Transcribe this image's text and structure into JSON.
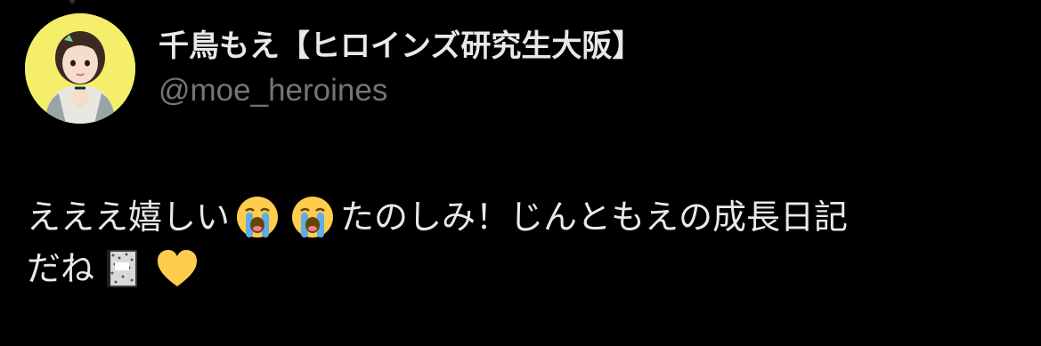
{
  "author": {
    "display_name": "千鳥もえ【ヒロインズ研究生大阪】",
    "handle": "@moe_heroines",
    "avatar_icon": "user-avatar-photo"
  },
  "tweet": {
    "line1": {
      "text_a": "えええ嬉しい",
      "emoji_1": "loudly-crying-face-icon",
      "emoji_2": "loudly-crying-face-icon",
      "text_b": "たのしみ！じんともえの成長日記"
    },
    "line2": {
      "text_a": "だね",
      "emoji_1": "notebook-icon",
      "emoji_2": "yellow-heart-icon"
    }
  },
  "colors": {
    "background": "#000000",
    "text_primary": "#e7e9ea",
    "text_secondary": "#71767b",
    "avatar_bg": "#f5ee6a",
    "heart": "#ffcc4d"
  }
}
